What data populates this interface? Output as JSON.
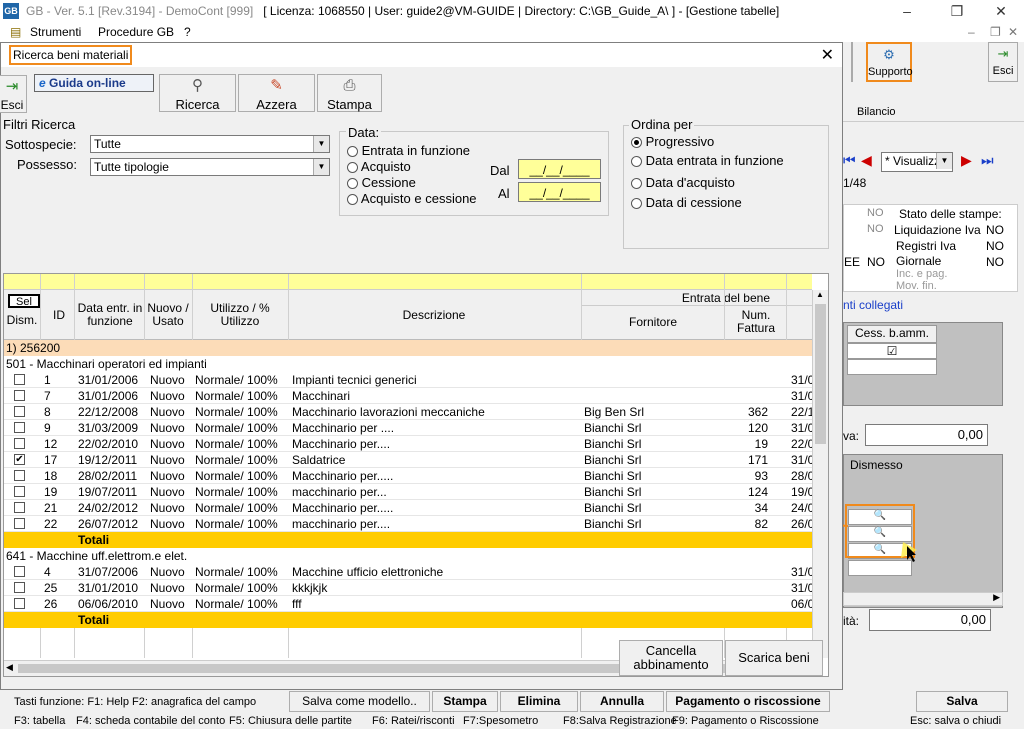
{
  "window": {
    "title_a": "GB - Ver. 5.1 [Rev.3194] - DemoCont [999]",
    "title_b": "[ Licenza: 1068550 | User: guide2@VM-GUIDE | Directory: C:\\GB_Guide_A\\ ] - [Gestione tabelle]",
    "icon": "GB"
  },
  "menu": {
    "strumenti": "Strumenti",
    "procedure": "Procedure GB",
    "help": "?"
  },
  "bg": {
    "supporto": "Supporto",
    "esci": "Esci",
    "bilancio": "Bilancio",
    "visualizza": "* Visualizz",
    "page": "1/48",
    "stato_title": "Stato delle stampe:",
    "liq_iva": "Liquidazione Iva",
    "reg_iva": "Registri Iva",
    "giornale": "Giornale",
    "inc_pag": "Inc. e pag.",
    "mov_fin": "Mov. fin.",
    "no": "NO",
    "ee": "EE",
    "linked": "nti collegati",
    "cess_bamm": "Cess. b.amm.",
    "va": "va:",
    "val1": "0,00",
    "dismesso": "Dismesso",
    "ita": "ità:",
    "val2": "0,00"
  },
  "dialog": {
    "title": "Ricerca beni materiali",
    "guida": "Guida on-line",
    "esci": "Esci",
    "buttons": {
      "ricerca": "Ricerca",
      "azzera": "Azzera",
      "stampa": "Stampa"
    },
    "filtri": {
      "title": "Filtri Ricerca",
      "sottospecie_label": "Sottospecie:",
      "sottospecie_value": "Tutte",
      "possesso_label": "Possesso:",
      "possesso_value": "Tutte tipologie"
    },
    "data": {
      "title": "Data:",
      "options": [
        "Entrata in funzione",
        "Acquisto",
        "Cessione",
        "Acquisto e cessione"
      ],
      "dal": "Dal",
      "al": "Al",
      "dal_value": "__/__/____",
      "al_value": "__/__/____"
    },
    "ordina": {
      "title": "Ordina per",
      "options": [
        "Progressivo",
        "Data entrata in funzione",
        "Data d'acquisto",
        "Data di cessione"
      ]
    },
    "table": {
      "headers": {
        "sel": "Sel",
        "dism": "Dism.",
        "id": "ID",
        "data_entr": "Data entr. in funzione",
        "nuovo": "Nuovo / Usato",
        "utilizzo": "Utilizzo / % Utilizzo",
        "descrizione": "Descrizione",
        "entrata": "Entrata del bene",
        "fornitore": "Fornitore",
        "num_fattura": "Num. Fattura"
      },
      "group1": "1) 256200",
      "sub1": "501 - Macchinari operatori ed impianti",
      "rows1": [
        {
          "id": "1",
          "data": "31/01/2006",
          "nu": "Nuovo",
          "ut": "Normale/ 100%",
          "desc": "Impianti tecnici generici",
          "forn": "",
          "num": "",
          "d2": "31/0",
          "chk": ""
        },
        {
          "id": "7",
          "data": "31/01/2006",
          "nu": "Nuovo",
          "ut": "Normale/ 100%",
          "desc": "Macchinari",
          "forn": "",
          "num": "",
          "d2": "31/0",
          "chk": ""
        },
        {
          "id": "8",
          "data": "22/12/2008",
          "nu": "Nuovo",
          "ut": "Normale/ 100%",
          "desc": "Macchinario lavorazioni meccaniche",
          "forn": "Big Ben Srl",
          "num": "362",
          "d2": "22/1",
          "chk": ""
        },
        {
          "id": "9",
          "data": "31/03/2009",
          "nu": "Nuovo",
          "ut": "Normale/ 100%",
          "desc": "Macchinario per ....",
          "forn": "Bianchi Srl",
          "num": "120",
          "d2": "31/0",
          "chk": ""
        },
        {
          "id": "12",
          "data": "22/02/2010",
          "nu": "Nuovo",
          "ut": "Normale/ 100%",
          "desc": "Macchinario per....",
          "forn": "Bianchi Srl",
          "num": "19",
          "d2": "22/0",
          "chk": ""
        },
        {
          "id": "17",
          "data": "19/12/2011",
          "nu": "Nuovo",
          "ut": "Normale/ 100%",
          "desc": "Saldatrice",
          "forn": "Bianchi Srl",
          "num": "171",
          "d2": "31/0",
          "chk": "✔"
        },
        {
          "id": "18",
          "data": "28/02/2011",
          "nu": "Nuovo",
          "ut": "Normale/ 100%",
          "desc": "Macchinario per.....",
          "forn": "Bianchi Srl",
          "num": "93",
          "d2": "28/0",
          "chk": ""
        },
        {
          "id": "19",
          "data": "19/07/2011",
          "nu": "Nuovo",
          "ut": "Normale/ 100%",
          "desc": "macchinario per...",
          "forn": "Bianchi Srl",
          "num": "124",
          "d2": "19/0",
          "chk": ""
        },
        {
          "id": "21",
          "data": "24/02/2012",
          "nu": "Nuovo",
          "ut": "Normale/ 100%",
          "desc": "Macchinario per.....",
          "forn": "Bianchi Srl",
          "num": "34",
          "d2": "24/0",
          "chk": ""
        },
        {
          "id": "22",
          "data": "26/07/2012",
          "nu": "Nuovo",
          "ut": "Normale/ 100%",
          "desc": "macchinario per....",
          "forn": "Bianchi Srl",
          "num": "82",
          "d2": "26/0",
          "chk": ""
        }
      ],
      "totali": "Totali",
      "sub2": "641 - Macchine uff.elettrom.e elet.",
      "rows2": [
        {
          "id": "4",
          "data": "31/07/2006",
          "nu": "Nuovo",
          "ut": "Normale/ 100%",
          "desc": "Macchine ufficio elettroniche",
          "forn": "",
          "num": "",
          "d2": "31/0",
          "chk": ""
        },
        {
          "id": "25",
          "data": "31/01/2010",
          "nu": "Nuovo",
          "ut": "Normale/ 100%",
          "desc": "kkkjkjk",
          "forn": "",
          "num": "",
          "d2": "31/0",
          "chk": ""
        },
        {
          "id": "26",
          "data": "06/06/2010",
          "nu": "Nuovo",
          "ut": "Normale/ 100%",
          "desc": "fff",
          "forn": "",
          "num": "",
          "d2": "06/0",
          "chk": ""
        }
      ],
      "totali2": "Totali"
    },
    "cancella": "Cancella abbinamento",
    "scarica": "Scarica beni"
  },
  "footer": {
    "line1": "Tasti funzione: F1: Help  F2: anagrafica del campo",
    "salva_modello": "Salva come modello..",
    "stampa": "Stampa",
    "elimina": "Elimina",
    "annulla": "Annulla",
    "pagamento": "Pagamento o riscossione",
    "salva": "Salva",
    "f3": "F3: tabella",
    "f4": "F4: scheda contabile del conto",
    "f5": "F5: Chiusura delle partite",
    "f6": "F6: Ratei/risconti",
    "f7": "F7:Spesometro",
    "f8": "F8:Salva Registrazione",
    "f9": "F9: Pagamento o Riscossione",
    "esc": "Esc: salva o chiudi"
  },
  "colors": {
    "accent": "#f08a1c",
    "yellow": "#ffcc00",
    "groupbg": "#fcdcb8"
  }
}
